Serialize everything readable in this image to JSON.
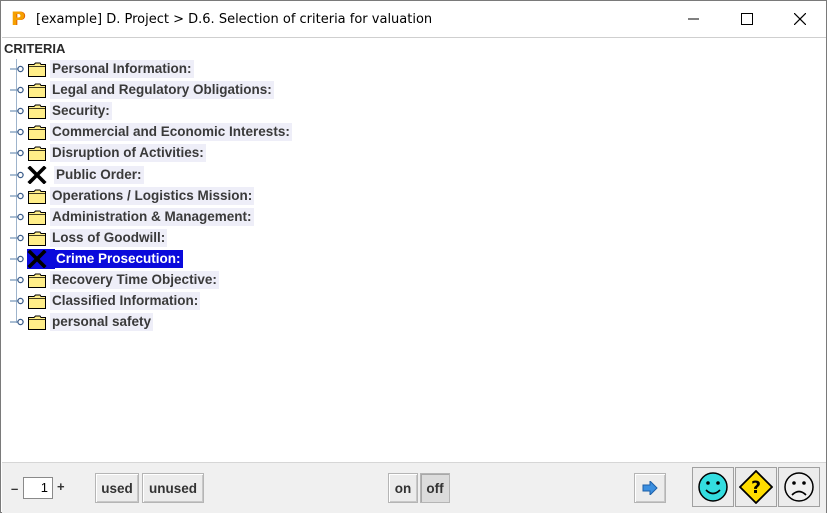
{
  "window": {
    "title": "[example] D. Project > D.6. Selection of criteria for valuation",
    "app_icon_glyph": "P",
    "controls": [
      "minimize-icon",
      "maximize-icon",
      "close-icon"
    ]
  },
  "tree": {
    "root_label": "CRITERIA",
    "items": [
      {
        "label": "Personal Information:",
        "icon": "folder-icon",
        "selected": false
      },
      {
        "label": "Legal and Regulatory Obligations:",
        "icon": "folder-icon",
        "selected": false
      },
      {
        "label": "Security:",
        "icon": "folder-icon",
        "selected": false
      },
      {
        "label": "Commercial and Economic Interests:",
        "icon": "folder-icon",
        "selected": false
      },
      {
        "label": "Disruption of Activities:",
        "icon": "folder-icon",
        "selected": false
      },
      {
        "label": "Public Order:",
        "icon": "x-mark-icon",
        "selected": false
      },
      {
        "label": "Operations / Logistics Mission:",
        "icon": "folder-icon",
        "selected": false
      },
      {
        "label": "Administration & Management:",
        "icon": "folder-icon",
        "selected": false
      },
      {
        "label": "Loss of Goodwill:",
        "icon": "folder-icon",
        "selected": false
      },
      {
        "label": "Crime Prosecution:",
        "icon": "x-mark-icon",
        "selected": true
      },
      {
        "label": "Recovery Time Objective:",
        "icon": "folder-icon",
        "selected": false
      },
      {
        "label": "Classified Information:",
        "icon": "folder-icon",
        "selected": false
      },
      {
        "label": "personal safety",
        "icon": "folder-icon",
        "selected": false
      }
    ]
  },
  "toolbar": {
    "minus_label": "–",
    "level_value": "1",
    "plus_label": "+",
    "used_label": "used",
    "unused_label": "unused",
    "on_label": "on",
    "off_label": "off",
    "next_icon": "arrow-right-icon",
    "status_icons": [
      "smiley-happy-icon",
      "warning-question-icon",
      "smiley-sad-icon"
    ]
  },
  "colors": {
    "selection": "#0a0adc",
    "folder": "#ffee88",
    "smiley_happy": "#33dde0",
    "warning": "#ffdd00",
    "next_arrow": "#3b8fe0"
  }
}
